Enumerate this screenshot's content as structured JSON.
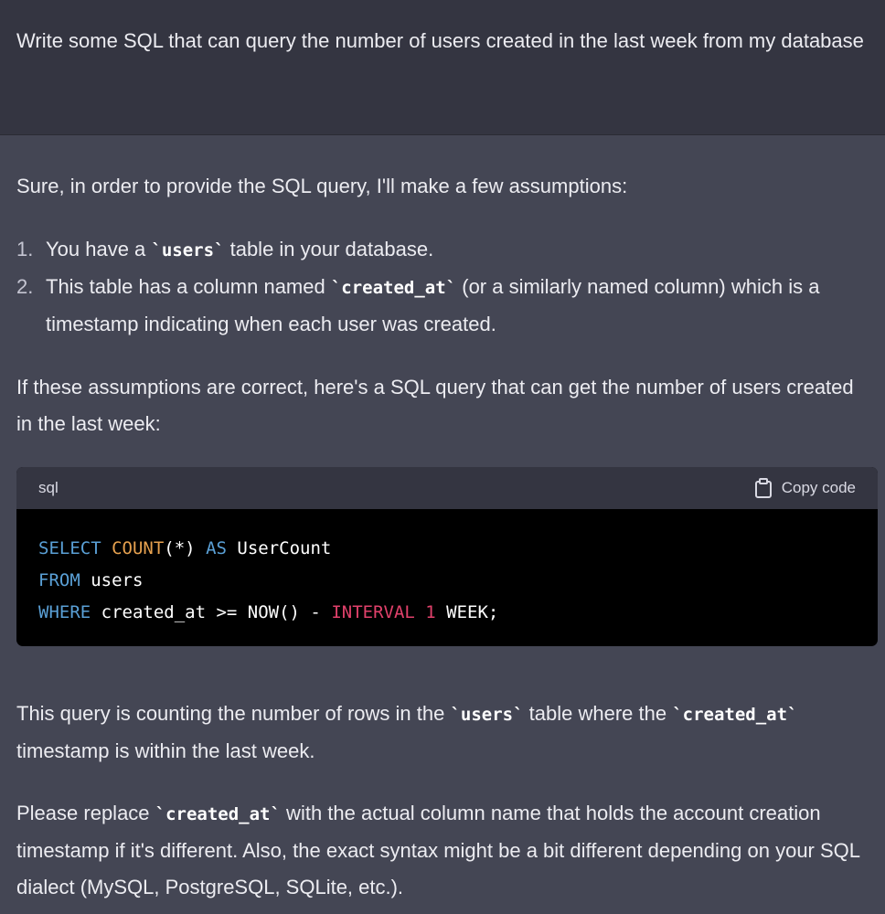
{
  "user_message": {
    "text": "Write some SQL that can query the number of users created in the last week from my database"
  },
  "assistant_message": {
    "intro": "Sure, in order to provide the SQL query, I'll make a few assumptions:",
    "assumptions": [
      {
        "number": "1.",
        "before": "You have a ",
        "code": "`users`",
        "after": " table in your database."
      },
      {
        "number": "2.",
        "before": "This table has a column named ",
        "code": "`created_at`",
        "after": " (or a similarly named column) which is a timestamp indicating when each user was created."
      }
    ],
    "lead_in": "If these assumptions are correct, here's a SQL query that can get the number of users created in the last week:",
    "code_block": {
      "language": "sql",
      "copy_label": "Copy code",
      "lines": [
        {
          "t1": "SELECT",
          "t2": " ",
          "t3": "COUNT",
          "t4": "(*) ",
          "t5": "AS",
          "t6": " UserCount"
        },
        {
          "t1": "FROM",
          "t2": " users"
        },
        {
          "t1": "WHERE",
          "t2": " created_at >= NOW() - ",
          "t3": "INTERVAL",
          "t4": " ",
          "t5": "1",
          "t6": " WEEK;"
        }
      ]
    },
    "explanation": {
      "before": "This query is counting the number of rows in the ",
      "code1": "`users`",
      "middle": " table where the ",
      "code2": "`created_at`",
      "after": " timestamp is within the last week."
    },
    "note": {
      "before": "Please replace ",
      "code": "`created_at`",
      "after": " with the actual column name that holds the account creation timestamp if it's different. Also, the exact syntax might be a bit different depending on your SQL dialect (MySQL, PostgreSQL, SQLite, etc.)."
    }
  },
  "colors": {
    "user_bg": "#343541",
    "assistant_bg": "#444654",
    "keyword": "#5aa0d6",
    "function": "#e6a14f",
    "interval": "#e0416b"
  },
  "icons": {
    "copy": "clipboard-icon"
  }
}
